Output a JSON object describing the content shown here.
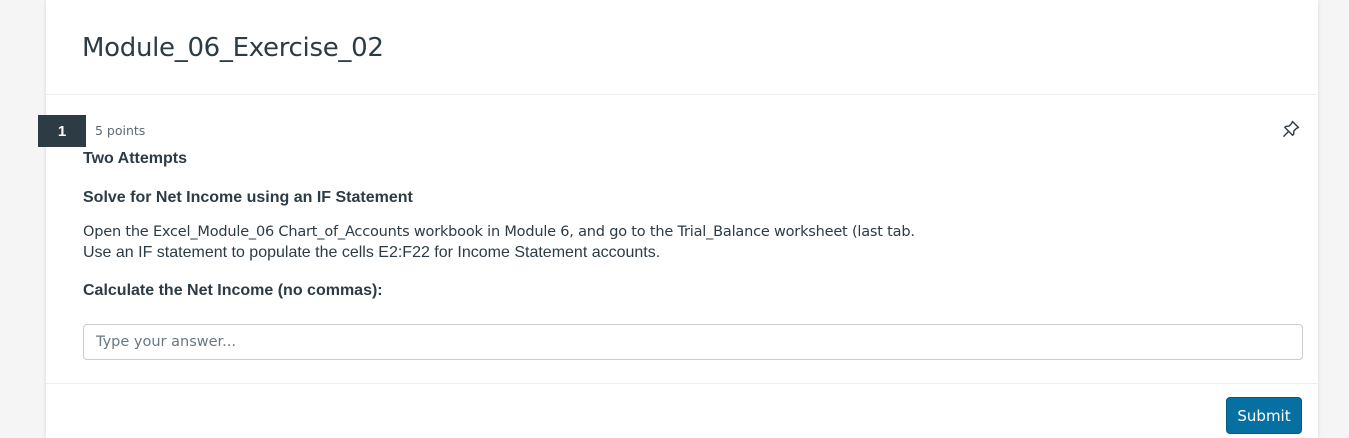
{
  "quiz": {
    "title": "Module_06_Exercise_02"
  },
  "question": {
    "number": "1",
    "points": "5 points",
    "attempts_label": "Two Attempts",
    "heading": "Solve for Net Income using an IF Statement",
    "instruction_line1": "Open the Excel_Module_06 Chart_of_Accounts workbook in Module 6, and go to the Trial_Balance worksheet (last tab.",
    "instruction_line2": "Use an IF statement to populate the cells E2:F22 for Income Statement accounts.",
    "prompt": "Calculate the Net Income (no commas):",
    "pin_icon": "pin-icon"
  },
  "answer": {
    "value": "",
    "placeholder": "Type your answer..."
  },
  "actions": {
    "submit_label": "Submit"
  },
  "colors": {
    "text": "#2d3b45",
    "number_badge_bg": "#2d3b45",
    "submit_bg": "#0770a3",
    "page_bg": "#f5f5f5"
  }
}
